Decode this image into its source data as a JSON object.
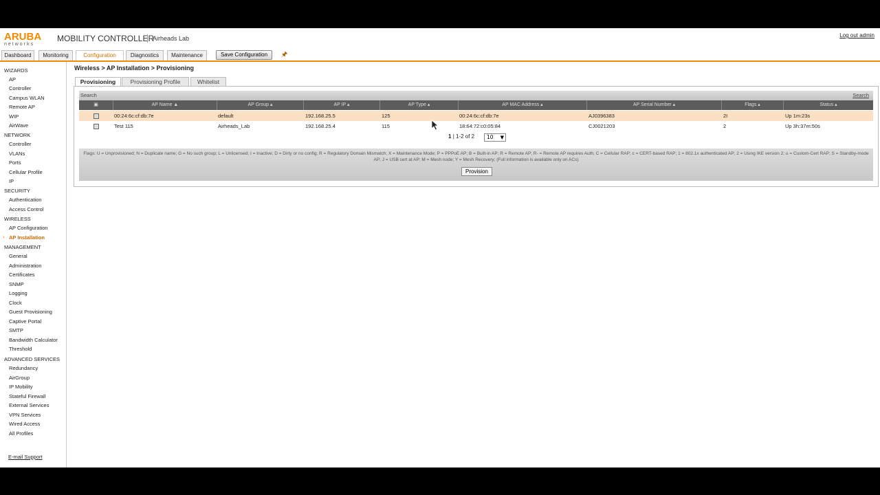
{
  "header": {
    "logo_top": "ARUBA",
    "logo_bottom": "networks",
    "product": "MOBILITY CONTROLLER",
    "location": "Airheads Lab",
    "logout": "Log out admin"
  },
  "nav": {
    "tabs": [
      "Dashboard",
      "Monitoring",
      "Configuration",
      "Diagnostics",
      "Maintenance"
    ],
    "active_tab": "Configuration",
    "save_label": "Save Configuration"
  },
  "sidebar": {
    "sections": [
      {
        "title": "WIZARDS",
        "items": [
          "AP",
          "Controller",
          "Campus WLAN",
          "Remote AP",
          "WIP",
          "AirWave"
        ]
      },
      {
        "title": "NETWORK",
        "items": [
          "Controller",
          "VLANs",
          "Ports",
          "Cellular Profile",
          "IP"
        ]
      },
      {
        "title": "SECURITY",
        "items": [
          "Authentication",
          "Access Control"
        ]
      },
      {
        "title": "WIRELESS",
        "items": [
          "AP Configuration",
          "AP Installation"
        ]
      },
      {
        "title": "MANAGEMENT",
        "items": [
          "General",
          "Administration",
          "Certificates",
          "SNMP",
          "Logging",
          "Clock",
          "Guest Provisioning",
          "Captive Portal",
          "SMTP",
          "Bandwidth Calculator",
          "Threshold"
        ]
      },
      {
        "title": "ADVANCED SERVICES",
        "items": [
          "Redundancy",
          "AirGroup",
          "IP Mobility",
          "Stateful Firewall",
          "External Services",
          "VPN Services",
          "Wired Access",
          "All Profiles"
        ]
      }
    ],
    "active_item": "AP Installation",
    "email_support": "E-mail Support"
  },
  "main": {
    "breadcrumb": "Wireless > AP Installation > Provisioning",
    "tabs": [
      "Provisioning",
      "Provisioning Profile",
      "Whitelist"
    ],
    "active_tab": "Provisioning",
    "search_label": "Search",
    "search_link": "Search",
    "columns": [
      "AP Name",
      "AP Group",
      "AP IP",
      "AP Type",
      "AP MAC Address",
      "AP Serial Number",
      "Flags",
      "Status"
    ],
    "rows": [
      {
        "name": "00:24:6c:cf:db:7e",
        "group": "default",
        "ip": "192.168.25.5",
        "type": "125",
        "mac": "00:24:6c:cf:db:7e",
        "serial": "AJ0396383",
        "flags": "2I",
        "status": "Up 1m:23s",
        "selected": true
      },
      {
        "name": "Test 115",
        "group": "Airheads_Lab",
        "ip": "192.168.25.4",
        "type": "115",
        "mac": "18:64:72:c0:05:84",
        "serial": "CJ0021203",
        "flags": "2",
        "status": "Up 3h:37m:50s",
        "selected": false
      }
    ],
    "pager": {
      "page": "1",
      "range": "1-2 of 2",
      "per_page": "10"
    },
    "legend": "Flags: U = Unprovisioned; N = Duplicate name; G = No such group; L = Unlicensed; I = Inactive; D = Dirty or no config; R = Regulatory Domain Mismatch; X = Maintenance Mode; P = PPPoE AP; B = Built-in AP; R = Remote AP; R- = Remote AP requires Auth; C = Cellular RAP; c = CERT-based RAP; 1 = 802.1x authenticated AP; 2 = Using IKE version 2; u = Custom-Cert RAP; S = Standby-mode AP; J = USB cert at AP; M = Mesh node; Y = Mesh Recovery; (Full information is available only on ACs)",
    "provision_label": "Provision"
  },
  "colors": {
    "accent": "#f28a00",
    "selected_row": "#fbe0c4",
    "header_bg": "#5c5c5c"
  }
}
